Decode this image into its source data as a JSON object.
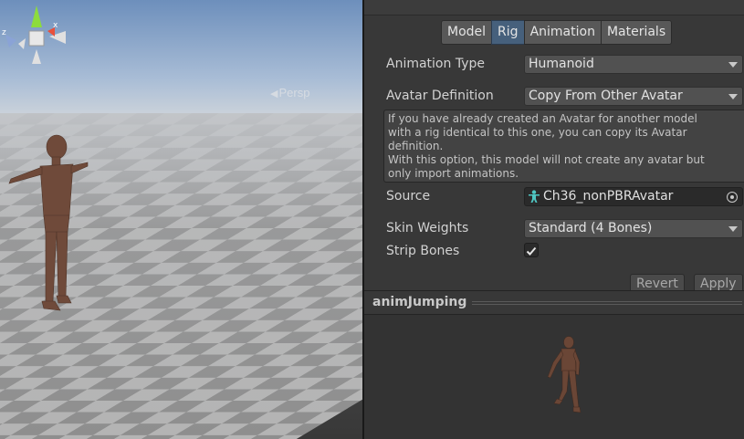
{
  "scene": {
    "projection_label": "Persp",
    "gizmo": {
      "x_label": "x",
      "z_label": "z"
    }
  },
  "inspector": {
    "tabs": [
      {
        "label": "Model",
        "active": false
      },
      {
        "label": "Rig",
        "active": true
      },
      {
        "label": "Animation",
        "active": false
      },
      {
        "label": "Materials",
        "active": false
      }
    ],
    "animation_type": {
      "label": "Animation Type",
      "value": "Humanoid"
    },
    "avatar_definition": {
      "label": "Avatar Definition",
      "value": "Copy From Other Avatar"
    },
    "help_text": "If you have already created an Avatar for another model\nwith a rig identical to this one, you can copy its Avatar\ndefinition.\nWith this option, this model will not create any avatar but\nonly import animations.",
    "source": {
      "label": "Source",
      "value": "Ch36_nonPBRAvatar",
      "icon": "avatar-icon"
    },
    "skin_weights": {
      "label": "Skin Weights",
      "value": "Standard (4 Bones)"
    },
    "strip_bones": {
      "label": "Strip Bones",
      "checked": true
    },
    "buttons": {
      "revert": "Revert",
      "apply": "Apply"
    }
  },
  "preview": {
    "title": "animJumping"
  },
  "colors": {
    "accent_tab": "#46607c",
    "panel_bg": "#383838",
    "sky_top": "#6d8fbc",
    "character": "#6f4a3a"
  }
}
